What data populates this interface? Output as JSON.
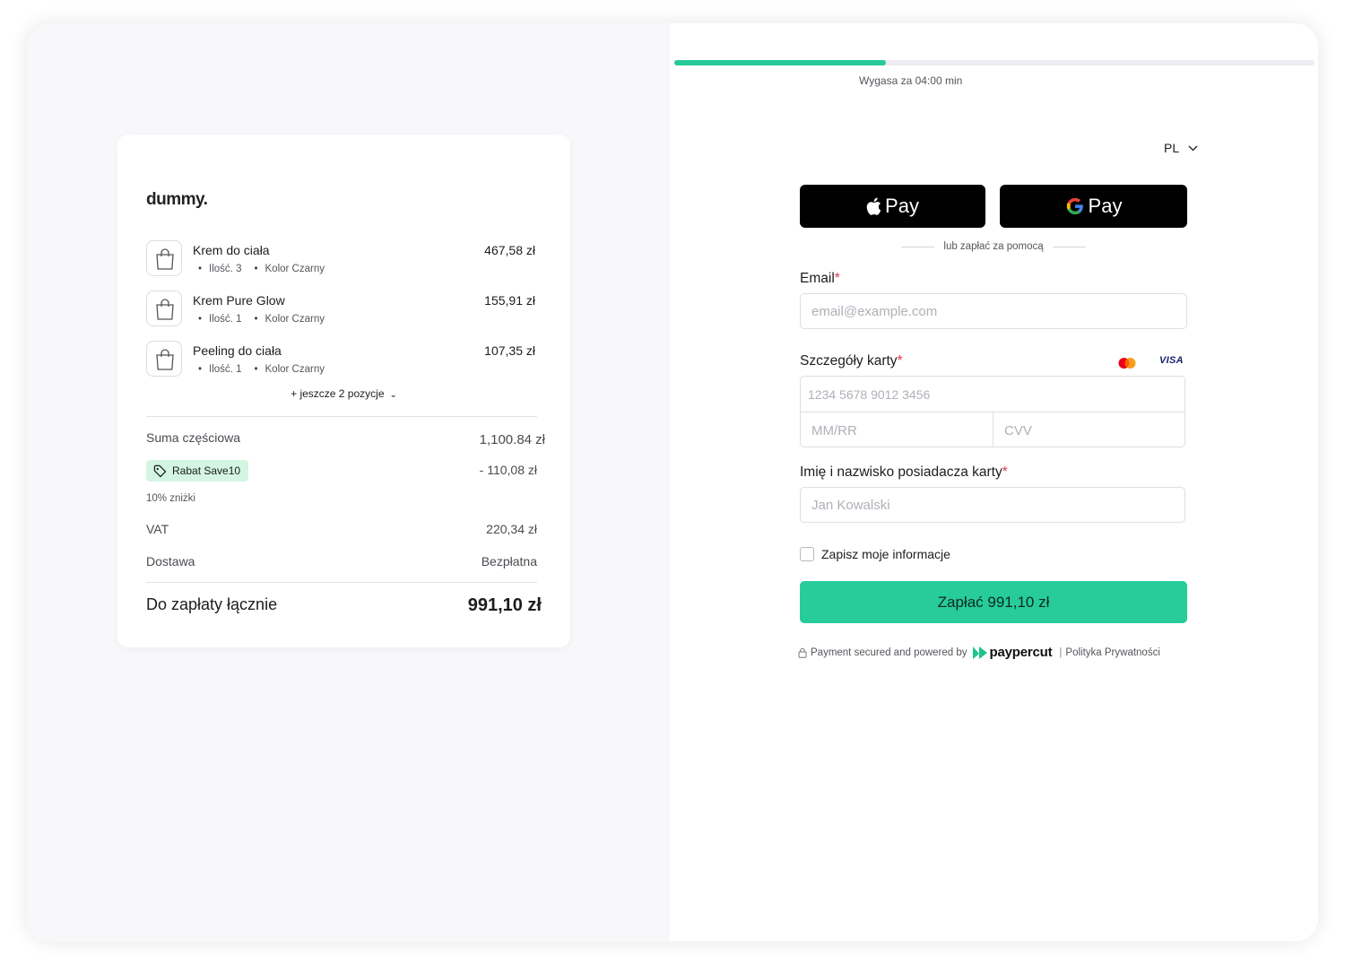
{
  "brand": "dummy.",
  "items": [
    {
      "name": "Krem do ciała",
      "price": "467,58 zł",
      "qty": "Ilość. 3",
      "color": "Kolor Czarny"
    },
    {
      "name": "Krem Pure Glow",
      "price": "155,91 zł",
      "qty": "Ilość. 1",
      "color": "Kolor Czarny"
    },
    {
      "name": "Peeling do ciała",
      "price": "107,35 zł",
      "qty": "Ilość. 1",
      "color": "Kolor Czarny"
    }
  ],
  "more_items": "+ jeszcze 2 pozycje",
  "summary": {
    "subtotal_label": "Suma częściowa",
    "subtotal_value": "1,100.84 zł",
    "discount_label": "Rabat Save10",
    "discount_value": "- 110,08 zł",
    "discount_note": "10% zniżki",
    "vat_label": "VAT",
    "vat_value": "220,34 zł",
    "shipping_label": "Dostawa",
    "shipping_value": "Bezpłatna",
    "total_label": "Do zapłaty łącznie",
    "total_value": "991,10 zł"
  },
  "timer": {
    "text": "Wygasa za 04:00 min",
    "progress_fraction": 0.33
  },
  "language": "PL",
  "wallets": {
    "apple_pay": "Pay",
    "google_pay": "Pay"
  },
  "divider_text": "lub zapłać za pomocą",
  "form": {
    "email_label": "Email",
    "email_placeholder": "email@example.com",
    "card_label": "Szczegóły karty",
    "card_number_placeholder": "1234 5678 9012 3456",
    "expiry_placeholder": "MM/RR",
    "cvv_placeholder": "CVV",
    "holder_label": "Imię i nazwisko posiadacza karty",
    "holder_placeholder": "Jan Kowalski",
    "required_mark": "*",
    "save_info_label": "Zapisz moje informacje",
    "card_brands": [
      "mastercard",
      "VISA"
    ]
  },
  "submit_label": "Zapłać 991,10 zł",
  "footer": {
    "secured_text": "Payment secured and powered by",
    "provider": "paypercut",
    "separator": "|",
    "privacy_link": "Polityka Prywatności"
  },
  "colors": {
    "accent": "#27cc9a",
    "progress": "#27c99a",
    "badge_bg": "#d3f5e2",
    "required": "#e0334c"
  }
}
